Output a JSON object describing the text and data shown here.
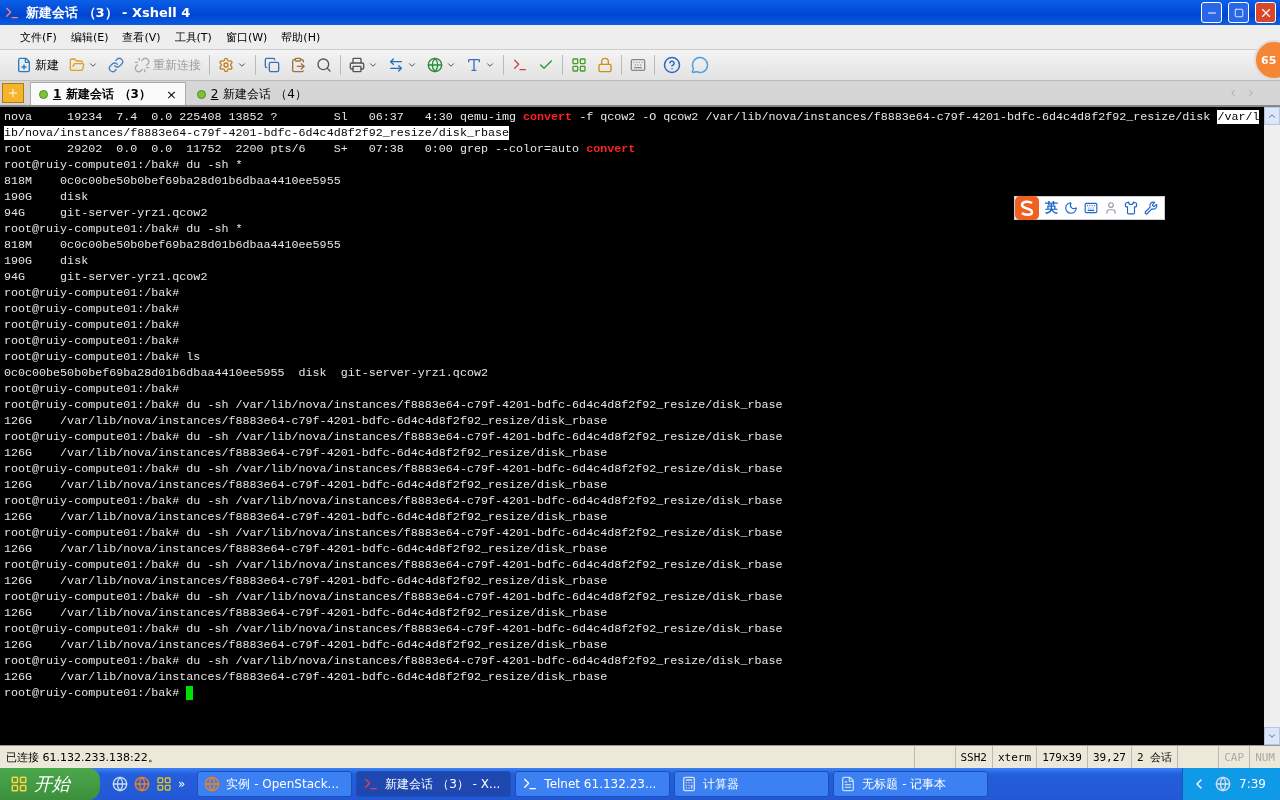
{
  "window": {
    "title": "新建会话 （3） - Xshell 4"
  },
  "menu": [
    "文件(F)",
    "编辑(E)",
    "查看(V)",
    "工具(T)",
    "窗口(W)",
    "帮助(H)"
  ],
  "toolbar": {
    "new_label": "新建",
    "reconnect": {
      "label": "重新连接",
      "disabled": true
    }
  },
  "tabs": [
    {
      "number": "1",
      "label": "新建会话 （3）",
      "selected": true,
      "close": "×"
    },
    {
      "number": "2",
      "label": "新建会话 （4）",
      "selected": false
    }
  ],
  "terminal": {
    "lines": [
      {
        "spans": [
          {
            "text": "nova     19234  7.4  0.0 225408 13852 ?        Sl   06:37   4:30 qemu-img ",
            "kind": "plain"
          },
          {
            "text": "convert",
            "kind": "match"
          },
          {
            "text": " -f qcow2 -O qcow2 /var/lib/nova/instances/f8883e64-c79f-4201-bdfc-6d4c4d8f2f92_resize/disk ",
            "kind": "plain"
          },
          {
            "text": "/var/l",
            "kind": "selected"
          }
        ]
      },
      {
        "spans": [
          {
            "text": "ib/nova/instances/f8883e64-c79f-4201-bdfc-6d4c4d8f2f92_resize/disk_rbase",
            "kind": "selected"
          }
        ]
      },
      {
        "spans": [
          {
            "text": "root     29202  0.0  0.0  11752  2200 pts/6    S+   07:38   0:00 grep --color=auto ",
            "kind": "plain"
          },
          {
            "text": "convert",
            "kind": "match"
          }
        ]
      },
      {
        "text": "root@ruiy-compute01:/bak# du -sh *"
      },
      {
        "text": "818M    0c0c00be50b0bef69ba28d01b6dbaa4410ee5955"
      },
      {
        "text": "190G    disk"
      },
      {
        "text": "94G     git-server-yrz1.qcow2"
      },
      {
        "text": "root@ruiy-compute01:/bak# du -sh *"
      },
      {
        "text": "818M    0c0c00be50b0bef69ba28d01b6dbaa4410ee5955"
      },
      {
        "text": "190G    disk"
      },
      {
        "text": "94G     git-server-yrz1.qcow2"
      },
      {
        "text": "root@ruiy-compute01:/bak#"
      },
      {
        "text": "root@ruiy-compute01:/bak#"
      },
      {
        "text": "root@ruiy-compute01:/bak#"
      },
      {
        "text": "root@ruiy-compute01:/bak#"
      },
      {
        "text": "root@ruiy-compute01:/bak# ls"
      },
      {
        "text": "0c0c00be50b0bef69ba28d01b6dbaa4410ee5955  disk  git-server-yrz1.qcow2"
      },
      {
        "text": "root@ruiy-compute01:/bak#"
      },
      {
        "text": "root@ruiy-compute01:/bak# du -sh /var/lib/nova/instances/f8883e64-c79f-4201-bdfc-6d4c4d8f2f92_resize/disk_rbase"
      },
      {
        "text": "126G    /var/lib/nova/instances/f8883e64-c79f-4201-bdfc-6d4c4d8f2f92_resize/disk_rbase"
      },
      {
        "text": "root@ruiy-compute01:/bak# du -sh /var/lib/nova/instances/f8883e64-c79f-4201-bdfc-6d4c4d8f2f92_resize/disk_rbase"
      },
      {
        "text": "126G    /var/lib/nova/instances/f8883e64-c79f-4201-bdfc-6d4c4d8f2f92_resize/disk_rbase"
      },
      {
        "text": "root@ruiy-compute01:/bak# du -sh /var/lib/nova/instances/f8883e64-c79f-4201-bdfc-6d4c4d8f2f92_resize/disk_rbase"
      },
      {
        "text": "126G    /var/lib/nova/instances/f8883e64-c79f-4201-bdfc-6d4c4d8f2f92_resize/disk_rbase"
      },
      {
        "text": "root@ruiy-compute01:/bak# du -sh /var/lib/nova/instances/f8883e64-c79f-4201-bdfc-6d4c4d8f2f92_resize/disk_rbase"
      },
      {
        "text": "126G    /var/lib/nova/instances/f8883e64-c79f-4201-bdfc-6d4c4d8f2f92_resize/disk_rbase"
      },
      {
        "text": "root@ruiy-compute01:/bak# du -sh /var/lib/nova/instances/f8883e64-c79f-4201-bdfc-6d4c4d8f2f92_resize/disk_rbase"
      },
      {
        "text": "126G    /var/lib/nova/instances/f8883e64-c79f-4201-bdfc-6d4c4d8f2f92_resize/disk_rbase"
      },
      {
        "text": "root@ruiy-compute01:/bak# du -sh /var/lib/nova/instances/f8883e64-c79f-4201-bdfc-6d4c4d8f2f92_resize/disk_rbase"
      },
      {
        "text": "126G    /var/lib/nova/instances/f8883e64-c79f-4201-bdfc-6d4c4d8f2f92_resize/disk_rbase"
      },
      {
        "text": "root@ruiy-compute01:/bak# du -sh /var/lib/nova/instances/f8883e64-c79f-4201-bdfc-6d4c4d8f2f92_resize/disk_rbase"
      },
      {
        "text": "126G    /var/lib/nova/instances/f8883e64-c79f-4201-bdfc-6d4c4d8f2f92_resize/disk_rbase"
      },
      {
        "text": "root@ruiy-compute01:/bak# du -sh /var/lib/nova/instances/f8883e64-c79f-4201-bdfc-6d4c4d8f2f92_resize/disk_rbase"
      },
      {
        "text": "126G    /var/lib/nova/instances/f8883e64-c79f-4201-bdfc-6d4c4d8f2f92_resize/disk_rbase"
      },
      {
        "text": "root@ruiy-compute01:/bak# du -sh /var/lib/nova/instances/f8883e64-c79f-4201-bdfc-6d4c4d8f2f92_resize/disk_rbase"
      },
      {
        "text": "126G    /var/lib/nova/instances/f8883e64-c79f-4201-bdfc-6d4c4d8f2f92_resize/disk_rbase"
      },
      {
        "text": "root@ruiy-compute01:/bak# ",
        "cursor": true
      }
    ]
  },
  "ime": {
    "mode": "英"
  },
  "badge": "65",
  "status_bar": {
    "connection": "已连接 61.132.233.138:22。",
    "cells": [
      "SSH2",
      "xterm",
      "179x39",
      "39,27",
      "2 会话"
    ],
    "indicators": [
      {
        "label": "CAP",
        "on": false
      },
      {
        "label": "NUM",
        "on": false
      }
    ]
  },
  "taskbar": {
    "start": "开始",
    "more": "»",
    "tasks": [
      {
        "label": "实例 - OpenStack...",
        "kind": "browser",
        "selected": false
      },
      {
        "label": "新建会话 （3） - X...",
        "kind": "xshell",
        "selected": true
      },
      {
        "label": "Telnet 61.132.23...",
        "kind": "console",
        "selected": false
      },
      {
        "label": "计算器",
        "kind": "calculator",
        "selected": false
      },
      {
        "label": "无标题 - 记事本",
        "kind": "notepad",
        "selected": false
      }
    ],
    "clock": "7:39"
  }
}
